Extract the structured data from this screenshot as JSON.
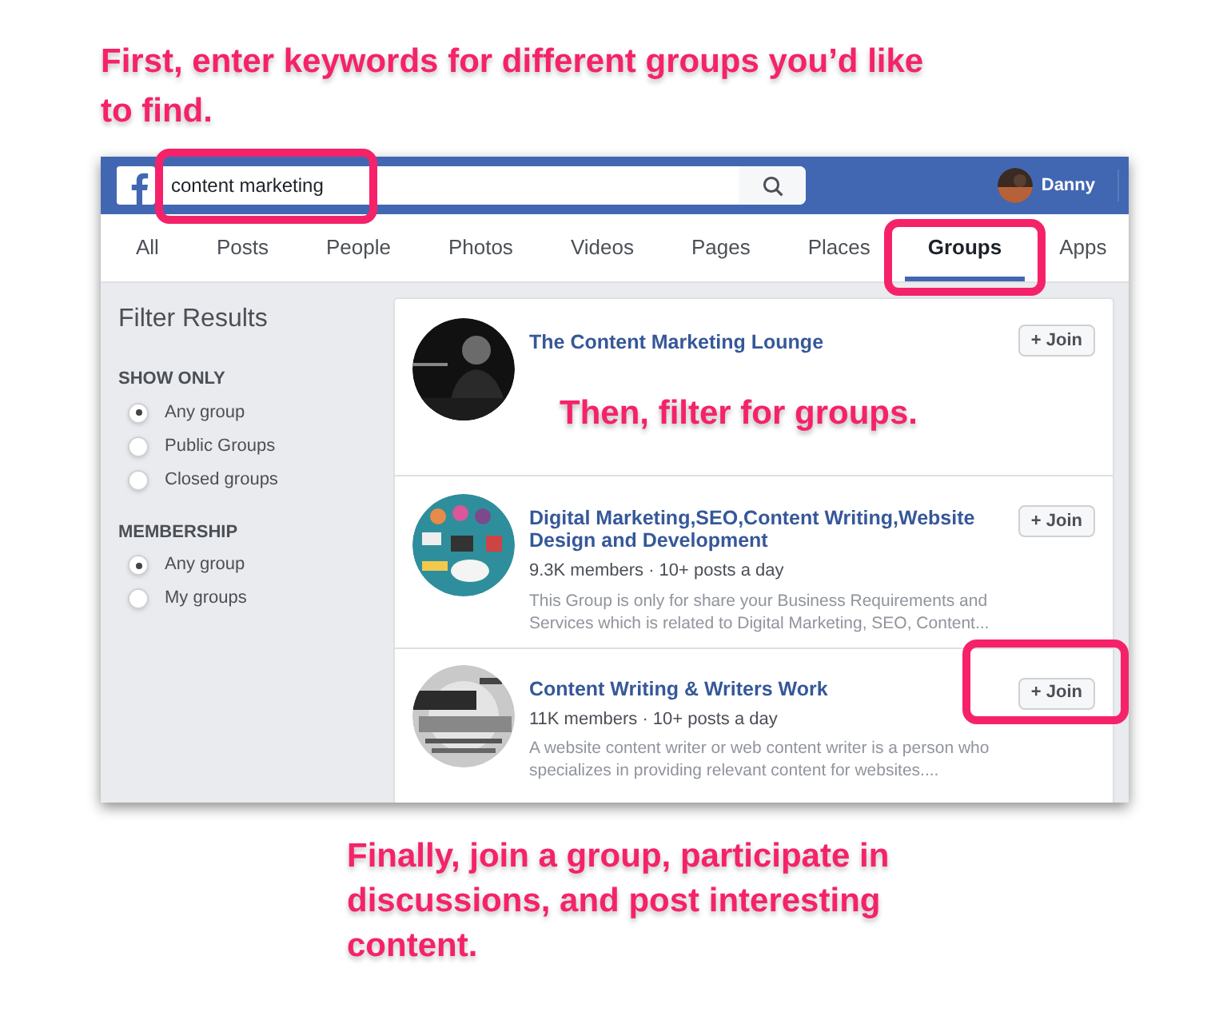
{
  "annotations": [
    {
      "text": "First, enter keywords for different groups you’d like to find."
    },
    {
      "text": "Then, filter for groups."
    },
    {
      "text": "Finally, join a group, participate in discussions, and post interesting content."
    }
  ],
  "header": {
    "search": {
      "value": "content marketing"
    },
    "user_name": "Danny"
  },
  "tabs": [
    {
      "label": "All",
      "selected": false
    },
    {
      "label": "Posts",
      "selected": false
    },
    {
      "label": "People",
      "selected": false
    },
    {
      "label": "Photos",
      "selected": false
    },
    {
      "label": "Videos",
      "selected": false
    },
    {
      "label": "Pages",
      "selected": false
    },
    {
      "label": "Places",
      "selected": false
    },
    {
      "label": "Groups",
      "selected": true
    },
    {
      "label": "Apps",
      "selected": false
    }
  ],
  "sidebar": {
    "title": "Filter Results",
    "sections": [
      {
        "heading": "SHOW ONLY",
        "options": [
          {
            "label": "Any group",
            "selected": true
          },
          {
            "label": "Public Groups",
            "selected": false
          },
          {
            "label": "Closed groups",
            "selected": false
          }
        ]
      },
      {
        "heading": "MEMBERSHIP",
        "options": [
          {
            "label": "Any group",
            "selected": true
          },
          {
            "label": "My groups",
            "selected": false
          }
        ]
      }
    ]
  },
  "results": [
    {
      "title": "The Content Marketing Lounge",
      "join_label": "+ Join"
    },
    {
      "title": "Digital Marketing,SEO,Content Writing,Website Design and Development",
      "meta": "9.3K members · 10+ posts a day",
      "description": "This Group is only for share your Business Requirements and Services which is related to Digital Marketing, SEO, Content...",
      "join_label": "+ Join"
    },
    {
      "title": "Content Writing & Writers Work",
      "meta": "11K members · 10+ posts a day",
      "description": "A website content writer or web content writer is a person who specializes in providing relevant content for websites....",
      "join_label": "+ Join"
    }
  ]
}
